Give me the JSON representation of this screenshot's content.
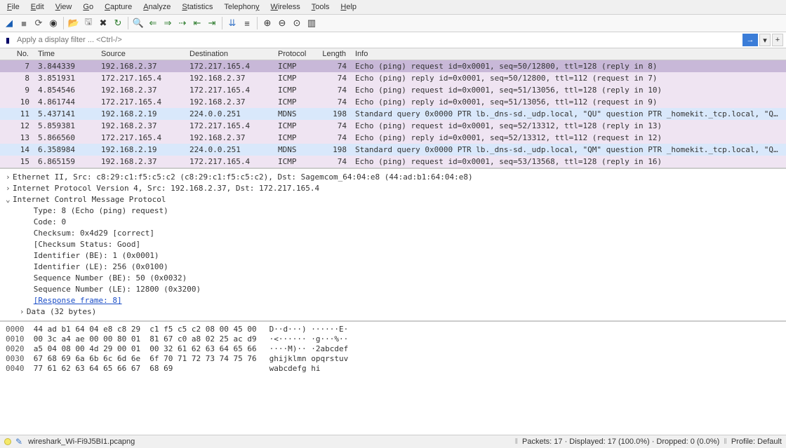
{
  "menu": {
    "file": "File",
    "edit": "Edit",
    "view": "View",
    "go": "Go",
    "capture": "Capture",
    "analyze": "Analyze",
    "statistics": "Statistics",
    "telephony": "Telephony",
    "wireless": "Wireless",
    "tools": "Tools",
    "help": "Help"
  },
  "filter": {
    "placeholder": "Apply a display filter ... <Ctrl-/>"
  },
  "packet_headers": {
    "no": "No.",
    "time": "Time",
    "source": "Source",
    "destination": "Destination",
    "protocol": "Protocol",
    "length": "Length",
    "info": "Info"
  },
  "packets": [
    {
      "no": "7",
      "time": "3.844339",
      "src": "192.168.2.37",
      "dst": "172.217.165.4",
      "proto": "ICMP",
      "len": "74",
      "info": "Echo (ping) request  id=0x0001, seq=50/12800, ttl=128 (reply in 8)",
      "cls": "row-selected"
    },
    {
      "no": "8",
      "time": "3.851931",
      "src": "172.217.165.4",
      "dst": "192.168.2.37",
      "proto": "ICMP",
      "len": "74",
      "info": "Echo (ping) reply    id=0x0001, seq=50/12800, ttl=112 (request in 7)",
      "cls": "row-icmp-rep"
    },
    {
      "no": "9",
      "time": "4.854546",
      "src": "192.168.2.37",
      "dst": "172.217.165.4",
      "proto": "ICMP",
      "len": "74",
      "info": "Echo (ping) request  id=0x0001, seq=51/13056, ttl=128 (reply in 10)",
      "cls": "row-icmp-req"
    },
    {
      "no": "10",
      "time": "4.861744",
      "src": "172.217.165.4",
      "dst": "192.168.2.37",
      "proto": "ICMP",
      "len": "74",
      "info": "Echo (ping) reply    id=0x0001, seq=51/13056, ttl=112 (request in 9)",
      "cls": "row-icmp-rep"
    },
    {
      "no": "11",
      "time": "5.437141",
      "src": "192.168.2.19",
      "dst": "224.0.0.251",
      "proto": "MDNS",
      "len": "198",
      "info": "Standard query 0x0000 PTR lb._dns-sd._udp.local, \"QU\" question PTR _homekit._tcp.local, \"QU\"…",
      "cls": "row-mdns"
    },
    {
      "no": "12",
      "time": "5.859381",
      "src": "192.168.2.37",
      "dst": "172.217.165.4",
      "proto": "ICMP",
      "len": "74",
      "info": "Echo (ping) request  id=0x0001, seq=52/13312, ttl=128 (reply in 13)",
      "cls": "row-icmp-req"
    },
    {
      "no": "13",
      "time": "5.866560",
      "src": "172.217.165.4",
      "dst": "192.168.2.37",
      "proto": "ICMP",
      "len": "74",
      "info": "Echo (ping) reply    id=0x0001, seq=52/13312, ttl=112 (request in 12)",
      "cls": "row-icmp-rep"
    },
    {
      "no": "14",
      "time": "6.358984",
      "src": "192.168.2.19",
      "dst": "224.0.0.251",
      "proto": "MDNS",
      "len": "198",
      "info": "Standard query 0x0000 PTR lb._dns-sd._udp.local, \"QM\" question PTR _homekit._tcp.local, \"QM\"…",
      "cls": "row-mdns"
    },
    {
      "no": "15",
      "time": "6.865159",
      "src": "192.168.2.37",
      "dst": "172.217.165.4",
      "proto": "ICMP",
      "len": "74",
      "info": "Echo (ping) request  id=0x0001, seq=53/13568, ttl=128 (reply in 16)",
      "cls": "row-icmp-req"
    }
  ],
  "details": {
    "eth": "Ethernet II, Src: c8:29:c1:f5:c5:c2 (c8:29:c1:f5:c5:c2), Dst: Sagemcom_64:04:e8 (44:ad:b1:64:04:e8)",
    "ip": "Internet Protocol Version 4, Src: 192.168.2.37, Dst: 172.217.165.4",
    "icmp": "Internet Control Message Protocol",
    "type": "Type: 8 (Echo (ping) request)",
    "code": "Code: 0",
    "checksum": "Checksum: 0x4d29 [correct]",
    "checksum_status": "[Checksum Status: Good]",
    "id_be": "Identifier (BE): 1 (0x0001)",
    "id_le": "Identifier (LE): 256 (0x0100)",
    "seq_be": "Sequence Number (BE): 50 (0x0032)",
    "seq_le": "Sequence Number (LE): 12800 (0x3200)",
    "resp": "[Response frame: 8]",
    "data": "Data (32 bytes)"
  },
  "bytes": [
    {
      "off": "0000",
      "hex": "44 ad b1 64 04 e8 c8 29  c1 f5 c5 c2 08 00 45 00",
      "ascii": "D··d···) ······E·"
    },
    {
      "off": "0010",
      "hex": "00 3c a4 ae 00 00 80 01  81 67 c0 a8 02 25 ac d9",
      "ascii": "·<······ ·g···%··"
    },
    {
      "off": "0020",
      "hex": "a5 04 08 00 4d 29 00 01  00 32 61 62 63 64 65 66",
      "ascii": "····M)·· ·2abcdef"
    },
    {
      "off": "0030",
      "hex": "67 68 69 6a 6b 6c 6d 6e  6f 70 71 72 73 74 75 76",
      "ascii": "ghijklmn opqrstuv"
    },
    {
      "off": "0040",
      "hex": "77 61 62 63 64 65 66 67  68 69                  ",
      "ascii": "wabcdefg hi"
    }
  ],
  "status": {
    "file": "wireshark_Wi-Fi9J5BI1.pcapng",
    "stats": "Packets: 17 · Displayed: 17 (100.0%) · Dropped: 0 (0.0%)",
    "profile": "Profile: Default"
  }
}
